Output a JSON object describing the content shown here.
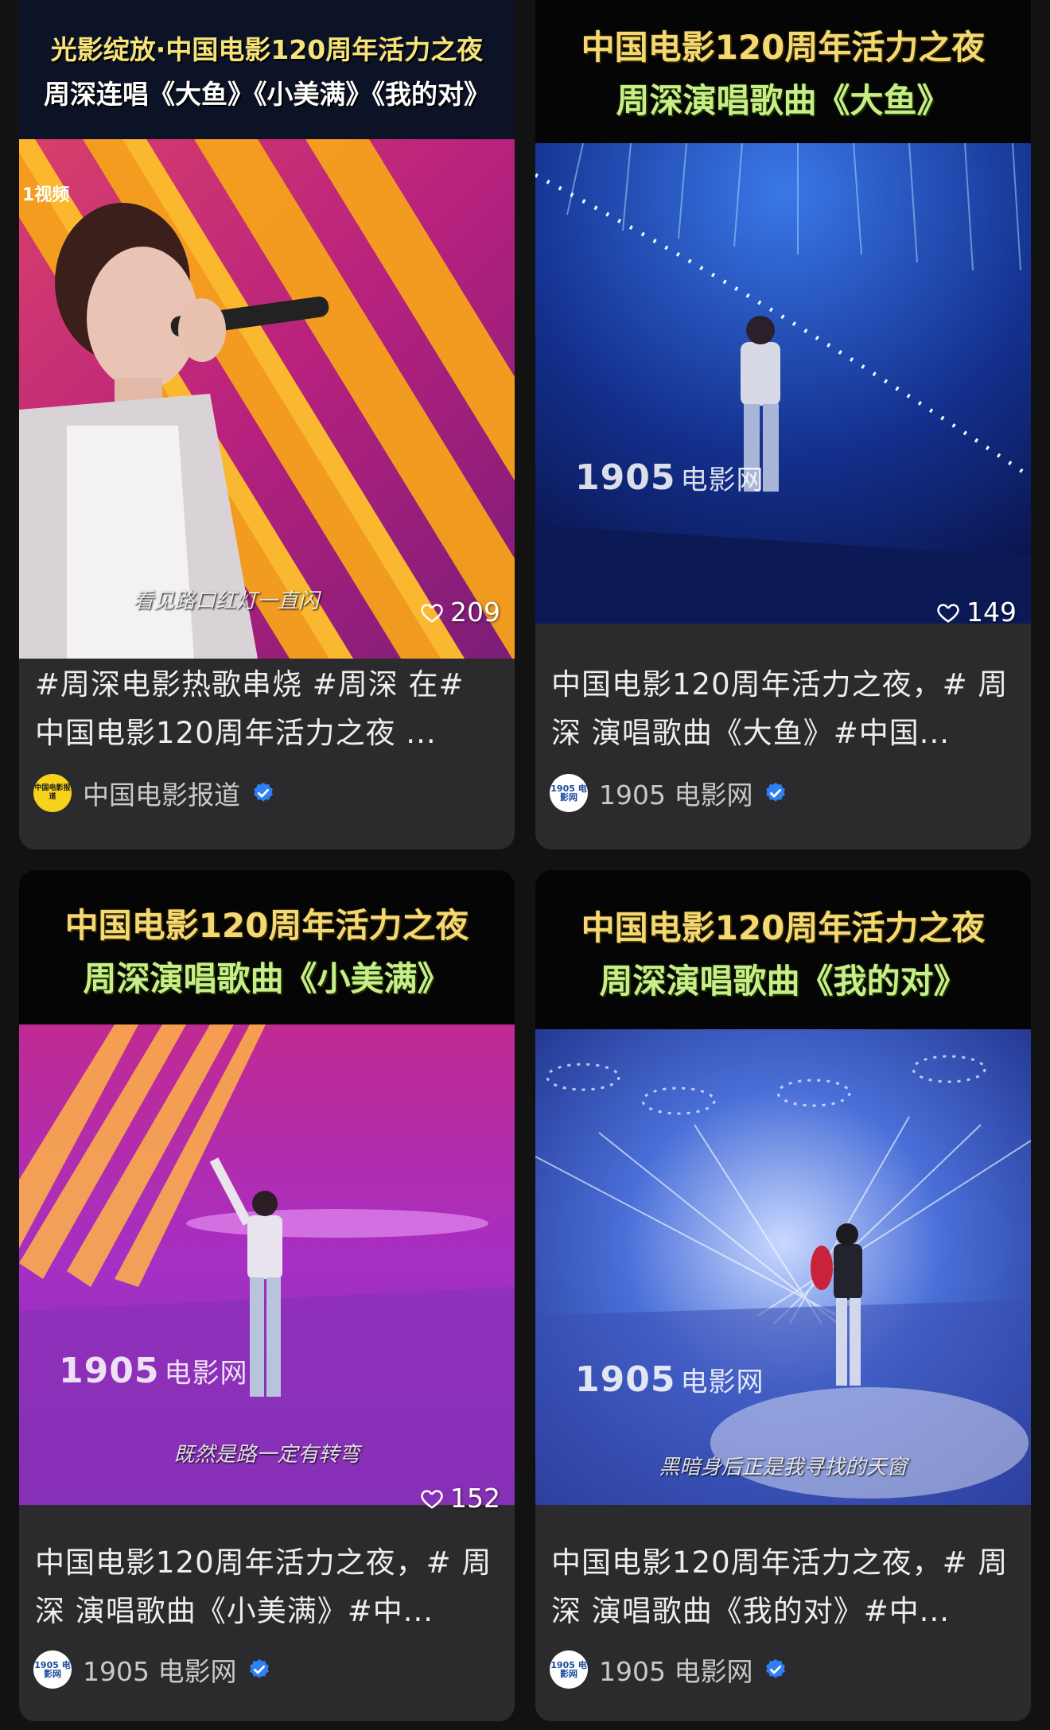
{
  "cards": [
    {
      "banner": [
        "光影绽放·中国电影120周年活力之夜",
        "周深连唱《大鱼》《小美满》《我的对》"
      ],
      "watermark_num": "",
      "watermark_cn": "",
      "corner_logo": "1视频",
      "subtitle": "看见路口红灯一直闪",
      "likes": "209",
      "title": "#周深电影热歌串烧 #周深 在# 中国电影120周年活力之夜 ...",
      "author": "中国电影报道",
      "avatar_text": "中国电影报道",
      "verified": true
    },
    {
      "banner": [
        "中国电影120周年活力之夜",
        "周深演唱歌曲《大鱼》"
      ],
      "watermark_num": "1905",
      "watermark_cn": "电影网",
      "corner_logo": "",
      "subtitle": "",
      "likes": "149",
      "title": "中国电影120周年活力之夜，# 周深 演唱歌曲《大鱼》#中国...",
      "author": "1905 电影网",
      "avatar_text": "1905 电影网",
      "verified": true
    },
    {
      "banner": [
        "中国电影120周年活力之夜",
        "周深演唱歌曲《小美满》"
      ],
      "watermark_num": "1905",
      "watermark_cn": "电影网",
      "corner_logo": "",
      "subtitle": "既然是路一定有转弯",
      "likes": "152",
      "title": "中国电影120周年活力之夜，# 周深 演唱歌曲《小美满》#中...",
      "author": "1905 电影网",
      "avatar_text": "1905 电影网",
      "verified": true
    },
    {
      "banner": [
        "中国电影120周年活力之夜",
        "周深演唱歌曲《我的对》"
      ],
      "watermark_num": "1905",
      "watermark_cn": "电影网",
      "corner_logo": "",
      "subtitle": "黑暗身后正是我寻找的天窗",
      "likes": "",
      "title": "中国电影120周年活力之夜，# 周深 演唱歌曲《我的对》#中...",
      "author": "1905 电影网",
      "avatar_text": "1905 电影网",
      "verified": true
    }
  ],
  "colors": {
    "background": "#121212",
    "card": "#2b2b2d",
    "title_text": "#eeeeee",
    "author_text": "#c9c9c9",
    "verified_blue": "#2f7ff5",
    "banner_gold": "#f4d873",
    "banner_green": "#c8ee8a"
  }
}
